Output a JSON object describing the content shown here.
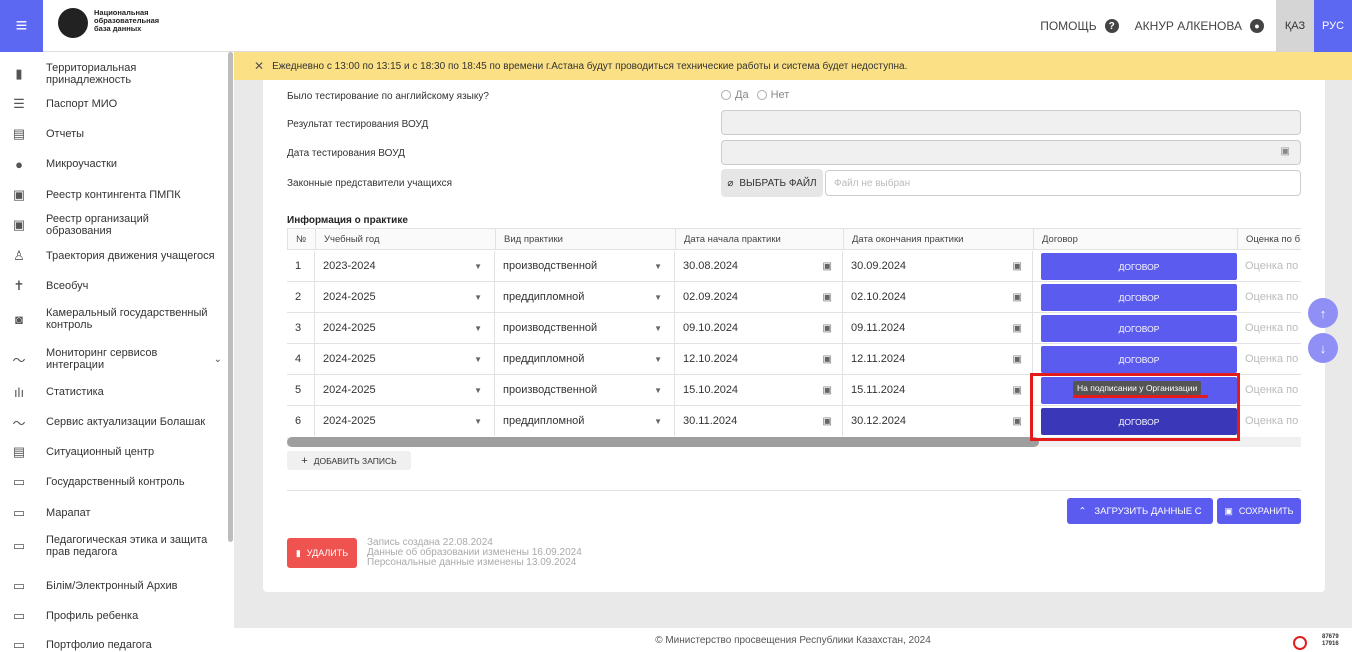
{
  "header": {
    "logo_text": "Национальная образовательная база данных",
    "help_label": "ПОМОЩЬ",
    "user_name": "АКНУР АЛКЕНОВА",
    "lang_kaz": "ҚАЗ",
    "lang_rus": "РУС"
  },
  "notice": {
    "text": "Ежедневно с 13:00 по 13:15 и с 18:30 по 18:45 по времени г.Астана будут проводиться технические работы и система будет недоступна."
  },
  "sidebar": {
    "items": [
      {
        "label": "Территориальная принадлежность",
        "icon": "map-icon"
      },
      {
        "label": "Паспорт МИО",
        "icon": "list-icon"
      },
      {
        "label": "Отчеты",
        "icon": "report-icon"
      },
      {
        "label": "Микроучастки",
        "icon": "location-icon"
      },
      {
        "label": "Реестр контингента ПМПК",
        "icon": "registry-icon"
      },
      {
        "label": "Реестр организаций образования",
        "icon": "registry-icon"
      },
      {
        "label": "Траектория движения учащегося",
        "icon": "person-walk-icon"
      },
      {
        "label": "Всеобуч",
        "icon": "person-icon"
      },
      {
        "label": "Камеральный государственный контроль",
        "icon": "inspect-icon"
      },
      {
        "label": "Мониторинг сервисов интеграции",
        "icon": "trend-icon"
      },
      {
        "label": "Статистика",
        "icon": "bar-chart-icon"
      },
      {
        "label": "Сервис актуализации Болашак",
        "icon": "trend-icon"
      },
      {
        "label": "Ситуационный центр",
        "icon": "report-icon"
      },
      {
        "label": "Государственный контроль",
        "icon": "card-icon"
      },
      {
        "label": "Марапат",
        "icon": "card-icon"
      },
      {
        "label": "Педагогическая этика и защита прав педагога",
        "icon": "card-icon"
      },
      {
        "label": "Білім/Электронный Архив",
        "icon": "card-icon"
      },
      {
        "label": "Профиль ребенка",
        "icon": "card-icon"
      },
      {
        "label": "Портфолио педагога",
        "icon": "card-icon"
      }
    ]
  },
  "form": {
    "english_test_label": "Было тестирование по английскому языку?",
    "yes_label": "Да",
    "no_label": "Нет",
    "voud_result_label": "Результат тестирования ВОУД",
    "voud_date_label": "Дата тестирования ВОУД",
    "representatives_label": "Законные представители учащихся",
    "choose_file_label": "ВЫБРАТЬ ФАЙЛ",
    "file_placeholder": "Файл не выбран"
  },
  "practice": {
    "title": "Информация о практике",
    "columns": [
      "№",
      "Учебный год",
      "Вид практики",
      "Дата начала практики",
      "Дата окончания практики",
      "Договор",
      "Оценка по б"
    ],
    "rows": [
      {
        "n": "1",
        "year": "2023-2024",
        "type": "производственной",
        "start": "30.08.2024",
        "end": "30.09.2024",
        "contract": "ДОГОВОР",
        "grade": "Оценка по"
      },
      {
        "n": "2",
        "year": "2024-2025",
        "type": "преддипломной",
        "start": "02.09.2024",
        "end": "02.10.2024",
        "contract": "ДОГОВОР",
        "grade": "Оценка по"
      },
      {
        "n": "3",
        "year": "2024-2025",
        "type": "производственной",
        "start": "09.10.2024",
        "end": "09.11.2024",
        "contract": "ДОГОВОР",
        "grade": "Оценка по"
      },
      {
        "n": "4",
        "year": "2024-2025",
        "type": "преддипломной",
        "start": "12.10.2024",
        "end": "12.11.2024",
        "contract": "ДОГОВОР",
        "grade": "Оценка по"
      },
      {
        "n": "5",
        "year": "2024-2025",
        "type": "производственной",
        "start": "15.10.2024",
        "end": "15.11.2024",
        "contract": "",
        "grade": "Оценка по"
      },
      {
        "n": "6",
        "year": "2024-2025",
        "type": "преддипломной",
        "start": "30.11.2024",
        "end": "30.12.2024",
        "contract": "ДОГОВОР",
        "grade": "Оценка по"
      }
    ],
    "tooltip": "На подписании у Организации",
    "add_label": "ДОБАВИТЬ ЗАПИСЬ"
  },
  "actions": {
    "load_label": "ЗАГРУЗИТЬ ДАННЫЕ С",
    "save_label": "СОХРАНИТЬ",
    "delete_label": "УДАЛИТЬ",
    "created": "Запись создана 22.08.2024",
    "edu_changed": "Данные об образовании изменены 16.09.2024",
    "personal_changed": "Персональные данные изменены 13.09.2024"
  },
  "footer": {
    "copyright": "© Министерство просвещения Республики Казахстан, 2024",
    "stat1": "87679",
    "stat2": "17916"
  }
}
